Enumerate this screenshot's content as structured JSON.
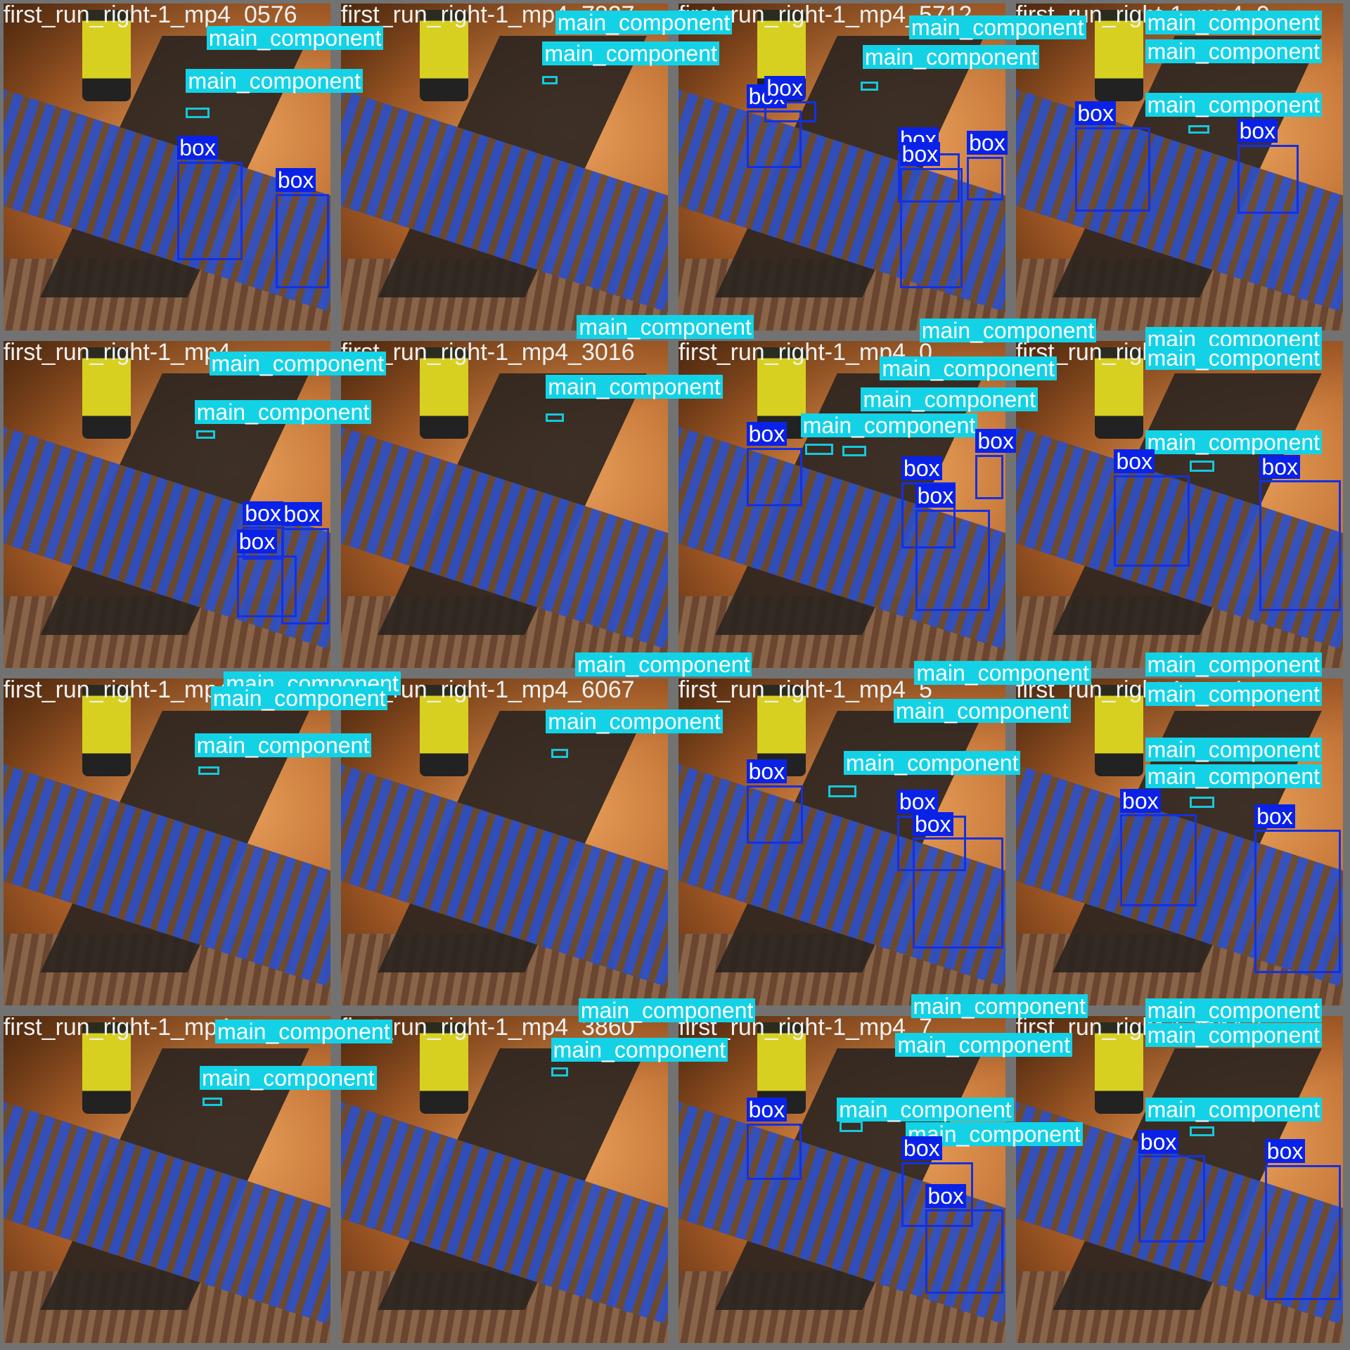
{
  "classes": {
    "box": "box",
    "main_component": "main_component"
  },
  "colors": {
    "box": "#0a22e8",
    "main_component": "#14d2e6"
  },
  "tiles": [
    {
      "title": "first_run_right-1_mp4_0576"
    },
    {
      "title": "first_run_right-1_mp4_7827"
    },
    {
      "title": "first_run_right-1_mp4_5712"
    },
    {
      "title": "first_run_right-1_mp4_9"
    },
    {
      "title": "first_run_right-1_mp4"
    },
    {
      "title": "first_run_right-1_mp4_3016"
    },
    {
      "title": "first_run_right-1_mp4_0"
    },
    {
      "title": "first_run_right-1_mp4"
    },
    {
      "title": "first_run_right-1_mp4"
    },
    {
      "title": "first_run_right-1_mp4_6067"
    },
    {
      "title": "first_run_right-1_mp4_5"
    },
    {
      "title": "first_run_right-1_mp4"
    },
    {
      "title": "first_run_right-1_mp4"
    },
    {
      "title": "first_run_right-1_mp4_3860"
    },
    {
      "title": "first_run_right-1_mp4_7"
    },
    {
      "title": "first_run_right-1_mp4_6"
    }
  ]
}
